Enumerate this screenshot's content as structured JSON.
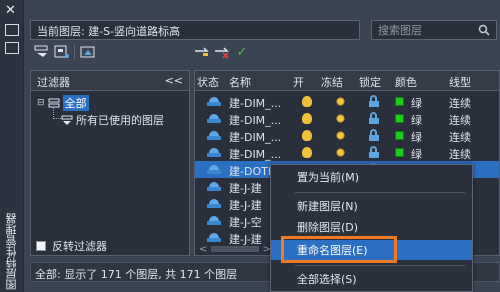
{
  "palette": {
    "bg": "#3b4453",
    "accent": "#2b6fc2",
    "highlight_box": "#ee7a23",
    "layer_color": "#18d018"
  },
  "window": {
    "close_glyph": "✕",
    "vertical_title": "图层特性管理器"
  },
  "header": {
    "current_layer_label": "当前图层: 建-S-竖向道路标高",
    "search_placeholder": "搜索图层",
    "search_icon": "search-icon"
  },
  "toolbar": {
    "icons": [
      "new-properties-filter-icon",
      "new-group-filter-icon",
      "layer-states-manager-icon",
      "new-layer-icon",
      "delete-layer-icon",
      "set-current-icon"
    ],
    "check_glyph": "✓"
  },
  "filters": {
    "title": "过滤器",
    "collapse": "<<",
    "root": "全部",
    "child": "所有已使用的图层",
    "invert_label": "反转过滤器"
  },
  "columns": [
    "状态",
    "名称",
    "开",
    "冻结",
    "锁定",
    "颜色",
    "线型"
  ],
  "layers": [
    {
      "name": "建-DIM_...",
      "color_name": "绿",
      "linetype": "连续",
      "selected": false
    },
    {
      "name": "建-DIM_...",
      "color_name": "绿",
      "linetype": "连续",
      "selected": false
    },
    {
      "name": "建-DIM_...",
      "color_name": "绿",
      "linetype": "连续",
      "selected": false
    },
    {
      "name": "建-DIM_...",
      "color_name": "绿",
      "linetype": "连续",
      "selected": false
    },
    {
      "name": "建-DOTE",
      "color_name": "",
      "linetype": "",
      "selected": true
    },
    {
      "name": "建-J-建",
      "color_name": "",
      "linetype": "",
      "selected": false
    },
    {
      "name": "建-J-建",
      "color_name": "",
      "linetype": "",
      "selected": false
    },
    {
      "name": "建-J-空",
      "color_name": "",
      "linetype": "",
      "selected": false
    },
    {
      "name": "建-J-建",
      "color_name": "",
      "linetype": "",
      "selected": false
    }
  ],
  "scroll": {
    "left": "<",
    "right": ">"
  },
  "status_bar": {
    "text": "全部: 显示了 171 个图层, 共 171 个图层"
  },
  "context_menu": {
    "items": [
      "置为当前(M)",
      "新建图层(N)",
      "删除图层(D)",
      "重命名图层(E)",
      "全部选择(S)"
    ],
    "highlighted_index": 3
  }
}
